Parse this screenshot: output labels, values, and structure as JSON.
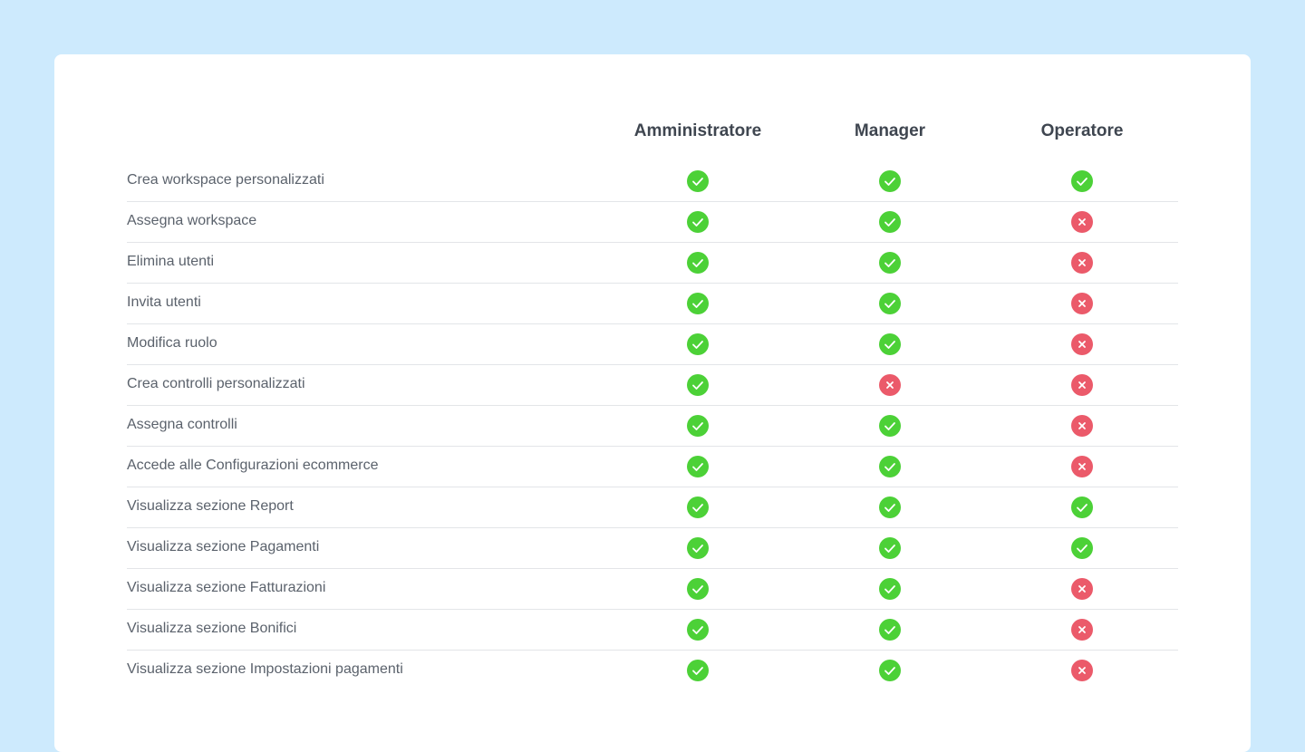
{
  "columns": [
    "Amministratore",
    "Manager",
    "Operatore"
  ],
  "rows": [
    {
      "label": "Crea workspace personalizzati",
      "values": [
        true,
        true,
        true
      ]
    },
    {
      "label": "Assegna workspace",
      "values": [
        true,
        true,
        false
      ]
    },
    {
      "label": "Elimina utenti",
      "values": [
        true,
        true,
        false
      ]
    },
    {
      "label": "Invita utenti",
      "values": [
        true,
        true,
        false
      ]
    },
    {
      "label": "Modifica ruolo",
      "values": [
        true,
        true,
        false
      ]
    },
    {
      "label": "Crea controlli personalizzati",
      "values": [
        true,
        false,
        false
      ]
    },
    {
      "label": "Assegna controlli",
      "values": [
        true,
        true,
        false
      ]
    },
    {
      "label": "Accede alle Configurazioni ecommerce",
      "values": [
        true,
        true,
        false
      ]
    },
    {
      "label": "Visualizza sezione Report",
      "values": [
        true,
        true,
        true
      ]
    },
    {
      "label": "Visualizza sezione Pagamenti",
      "values": [
        true,
        true,
        true
      ]
    },
    {
      "label": "Visualizza sezione Fatturazioni",
      "values": [
        true,
        true,
        false
      ]
    },
    {
      "label": "Visualizza sezione Bonifici",
      "values": [
        true,
        true,
        false
      ]
    },
    {
      "label": "Visualizza sezione Impostazioni pagamenti",
      "values": [
        true,
        true,
        false
      ]
    }
  ],
  "icons": {
    "yes": "check-circle-icon",
    "no": "x-circle-icon"
  },
  "colors": {
    "yes": "#4cd137",
    "no": "#eb5a6a",
    "background": "#cdeafd"
  }
}
